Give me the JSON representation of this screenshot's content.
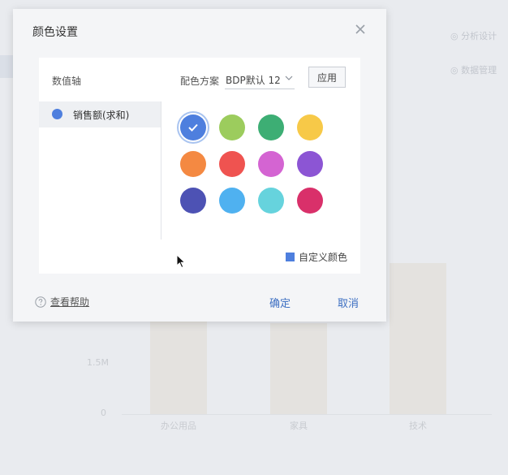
{
  "dialog": {
    "title": "颜色设置",
    "axis_label": "数值轴",
    "scheme_label": "配色方案",
    "scheme_value": "BDP默认 12",
    "apply_label": "应用",
    "series": [
      {
        "label": "销售额(求和)",
        "color": "#4e7fde"
      }
    ],
    "swatches": [
      {
        "color": "#4e7fde",
        "selected": true
      },
      {
        "color": "#9ccc5d"
      },
      {
        "color": "#3dae74"
      },
      {
        "color": "#f7c948"
      },
      {
        "color": "#f48942"
      },
      {
        "color": "#ef5350"
      },
      {
        "color": "#d464d2"
      },
      {
        "color": "#8c55d4"
      },
      {
        "color": "#4d52b4"
      },
      {
        "color": "#4fb1f0"
      },
      {
        "color": "#66d3dd"
      },
      {
        "color": "#d9306a"
      }
    ],
    "custom_color_label": "自定义颜色",
    "custom_color_swatch": "#4e7fde",
    "help_label": "查看帮助",
    "ok_label": "确定",
    "cancel_label": "取消"
  },
  "background": {
    "side_items": [
      "◎ 分析设计",
      "◎ 数据管理"
    ],
    "chart": {
      "tick_labels": [
        "1.5M",
        "0"
      ],
      "categories": [
        "办公用品",
        "家具",
        "技术"
      ]
    }
  },
  "colors": {
    "accent": "#3d6fc2",
    "selection_ring": "#a9c4f0"
  }
}
